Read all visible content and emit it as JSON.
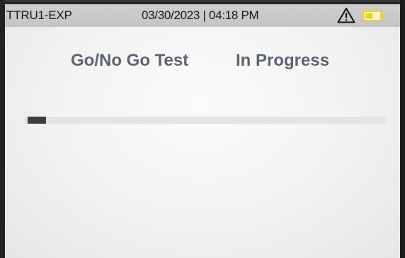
{
  "status_bar": {
    "device_name": "TTRU1-EXP",
    "datetime": "03/30/2023 | 04:18 PM",
    "warning_icon": "warning-triangle-icon",
    "battery_icon": "battery-low-icon",
    "battery_color": "#f2d21c"
  },
  "main": {
    "test_name": "Go/No Go Test",
    "test_status": "In Progress",
    "progress_fraction": 0.05
  },
  "colors": {
    "title_text": "#5d6470",
    "progress_fill": "#3b3f44",
    "progress_track": "#e3e3e3"
  }
}
